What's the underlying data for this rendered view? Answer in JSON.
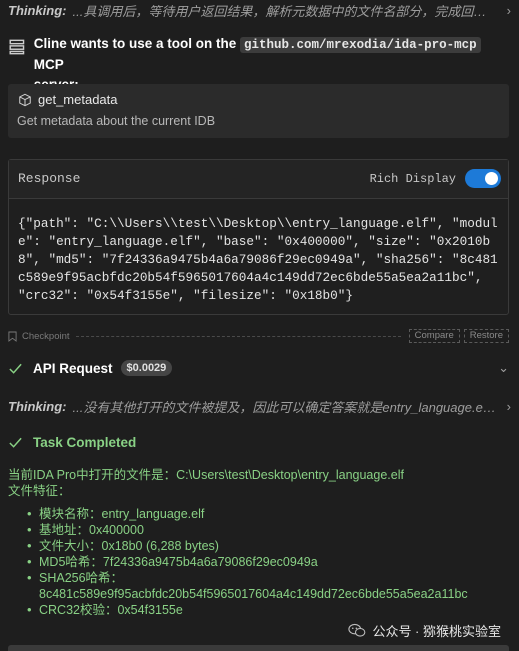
{
  "thinking_top": {
    "label": "Thinking:",
    "text": "...具调用后，等待用户返回结果，解析元数据中的文件名部分，完成回答。"
  },
  "mcp_header": {
    "prefix": "Cline wants to use a tool on the",
    "server": "github.com/mrexodia/ida-pro-mcp",
    "suffix_1": "MCP",
    "suffix_2": "server:"
  },
  "tool": {
    "name": "get_metadata",
    "description": "Get metadata about the current IDB"
  },
  "response": {
    "label": "Response",
    "rich_display_label": "Rich Display",
    "rich_display_on": true,
    "body": "{\"path\": \"C:\\\\Users\\\\test\\\\Desktop\\\\entry_language.elf\", \"module\": \"entry_language.elf\", \"base\": \"0x400000\", \"size\": \"0x2010b8\", \"md5\": \"7f24336a9475b4a6a79086f29ec0949a\", \"sha256\": \"8c481c589e9f95acbfdc20b54f5965017604a4c149dd72ec6bde55a5ea2a11bc\", \"crc32\": \"0x54f3155e\", \"filesize\": \"0x18b0\"}"
  },
  "checkpoint": {
    "label": "Checkpoint",
    "compare_label": "Compare",
    "restore_label": "Restore"
  },
  "api_request": {
    "title": "API Request",
    "cost": "$0.0029"
  },
  "thinking_bottom": {
    "label": "Thinking:",
    "text": "...没有其他打开的文件被提及，因此可以确定答案就是entry_language.elf。"
  },
  "task": {
    "title": "Task Completed",
    "line1": "当前IDA Pro中打开的文件是：C:\\Users\\test\\Desktop\\entry_language.elf",
    "line2": "文件特征：",
    "items": [
      "模块名称：entry_language.elf",
      "基地址：0x400000",
      "文件大小：0x18b0 (6,288 bytes)",
      "MD5哈希：7f24336a9475b4a6a79086f29ec0949a",
      "SHA256哈希：",
      "CRC32校验：0x54f3155e"
    ],
    "sha256_value": "8c481c589e9f95acbfdc20b54f5965017604a4c149dd72ec6bde55a5ea2a11bc"
  },
  "watermark": {
    "text": "公众号 · 猕猴桃实验室"
  },
  "colors": {
    "background": "#1e1e1e",
    "success_green": "#89d185",
    "toggle_blue": "#1d7ad8"
  },
  "icons": [
    "chevron-right-icon",
    "server-icon",
    "cube-icon",
    "bookmark-icon",
    "check-icon",
    "wechat-icon"
  ]
}
